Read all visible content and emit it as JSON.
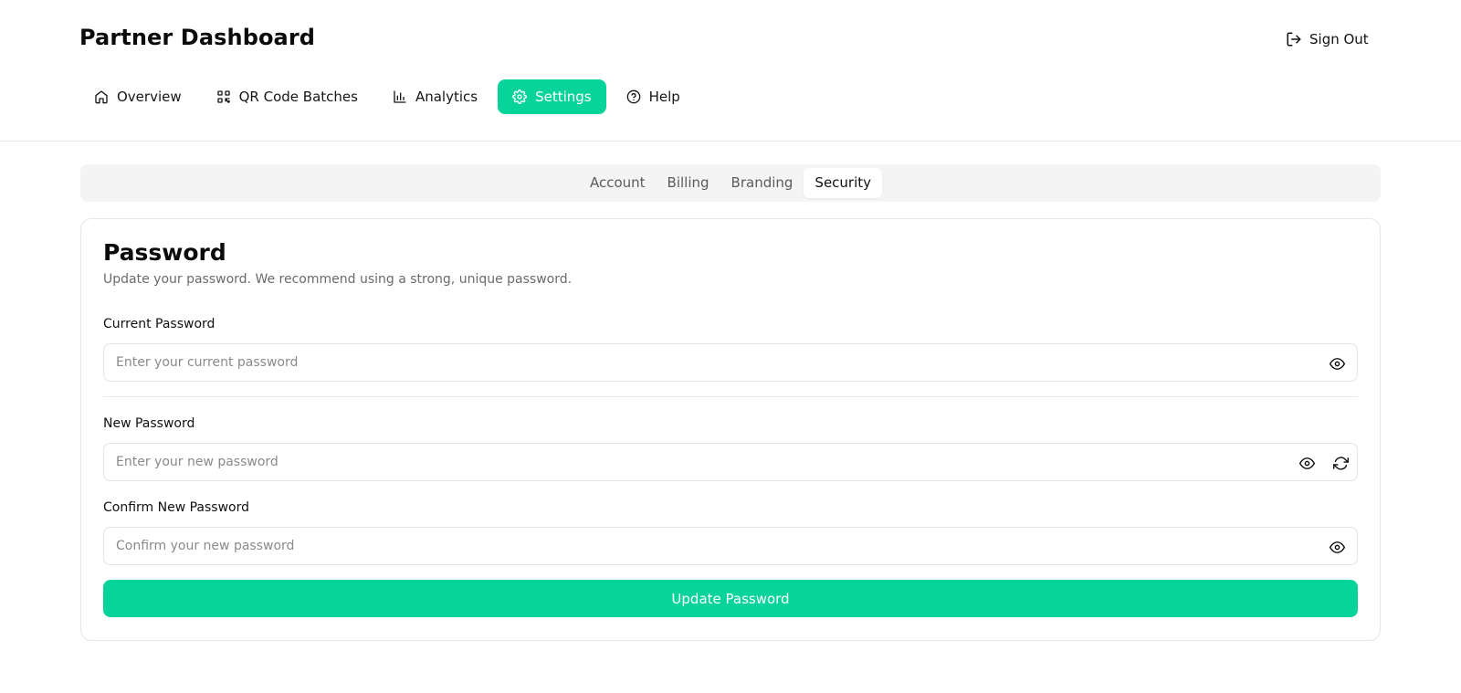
{
  "app": {
    "title": "Partner Dashboard",
    "sign_out": "Sign Out"
  },
  "nav": {
    "items": [
      {
        "label": "Overview",
        "icon": "home-icon"
      },
      {
        "label": "QR Code Batches",
        "icon": "qr-code-icon"
      },
      {
        "label": "Analytics",
        "icon": "bar-chart-icon"
      },
      {
        "label": "Settings",
        "icon": "gear-icon",
        "active": true
      },
      {
        "label": "Help",
        "icon": "help-circle-icon"
      }
    ]
  },
  "settings_tabs": [
    {
      "label": "Account"
    },
    {
      "label": "Billing"
    },
    {
      "label": "Branding"
    },
    {
      "label": "Security",
      "active": true
    }
  ],
  "password_card": {
    "title": "Password",
    "description": "Update your password. We recommend using a strong, unique password.",
    "current": {
      "label": "Current Password",
      "placeholder": "Enter your current password",
      "value": ""
    },
    "new": {
      "label": "New Password",
      "placeholder": "Enter your new password",
      "value": ""
    },
    "confirm": {
      "label": "Confirm New Password",
      "placeholder": "Confirm your new password",
      "value": ""
    },
    "submit_label": "Update Password"
  },
  "colors": {
    "accent": "#08d39a",
    "border": "#e6e6e6",
    "muted_text": "#6b6b6b",
    "tab_bg": "#f4f4f5"
  }
}
